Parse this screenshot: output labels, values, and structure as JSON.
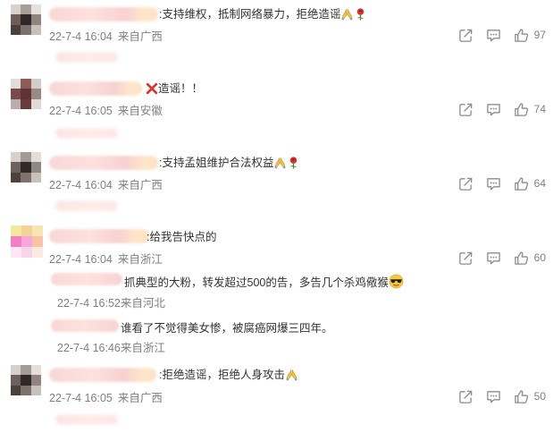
{
  "comments": [
    {
      "text": ":支持维权，抵制网络暴力，拒绝造谣",
      "time": "22-7-4 16:04",
      "location": "来自广西",
      "likes": "97",
      "emoji": [
        "pray",
        "rose"
      ]
    },
    {
      "text": "造谣！！",
      "time": "22-7-4 16:05",
      "location": "来自安徽",
      "likes": "74",
      "emoji_before": "cross-mark"
    },
    {
      "text": ":支持孟姐维护合法权益",
      "time": "22-7-4 16:04",
      "location": "来自广西",
      "likes": "64",
      "emoji": [
        "pray",
        "rose"
      ]
    },
    {
      "text": ":给我告快点的",
      "time": "22-7-4 16:04",
      "location": "来自浙江",
      "likes": "60",
      "replies": [
        {
          "text": "抓典型的大粉，转发超过500的告，多告几个杀鸡儆猴",
          "time": "22-7-4 16:52",
          "location": "来自河北",
          "emoji": "sunglasses"
        },
        {
          "text": "谁看了不觉得美女惨，被腐癌网爆三四年。",
          "time": "22-7-4 16:46",
          "location": "来自浙江"
        }
      ]
    },
    {
      "text": ":拒绝造谣，拒绝人身攻击",
      "time": "22-7-4 16:05",
      "location": "来自广西",
      "likes": "50",
      "emoji": [
        "pray"
      ]
    }
  ]
}
